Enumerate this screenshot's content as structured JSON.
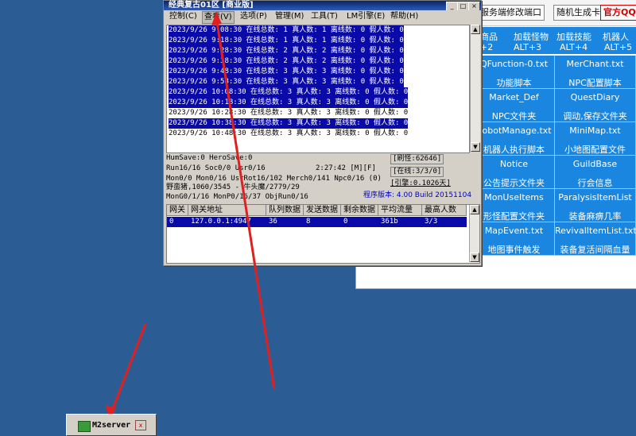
{
  "background_tool": {
    "top_tabs": [
      "服务端修改端口",
      "随机生成卡密",
      "官方QQ群"
    ],
    "blue_row_top": [
      "商品",
      "加载怪物",
      "加载技能",
      "机器人"
    ],
    "blue_row_bottom": [
      "+2",
      "ALT+3",
      "ALT+4",
      "ALT+5"
    ],
    "tiles": [
      {
        "file": "QFunction-0.txt",
        "desc": "功能脚本"
      },
      {
        "file": "MerChant.txt",
        "desc": "NPC配置脚本"
      },
      {
        "file": "Market_Def",
        "desc": "NPC文件夹"
      },
      {
        "file": "QuestDiary",
        "desc": "调动,保存文件夹"
      },
      {
        "file": "RobotManage.txt",
        "desc": "机器人执行脚本"
      },
      {
        "file": "MiniMap.txt",
        "desc": "小地图配置文件"
      },
      {
        "file": "Notice",
        "desc": "公告提示文件夹"
      },
      {
        "file": "GuildBase",
        "desc": "行会信息"
      },
      {
        "file": "MonUseItems",
        "desc": "形怪配置文件夹"
      },
      {
        "file": "ParalysisItemList",
        "desc": "装备麻痹几率"
      },
      {
        "file": "MapEvent.txt",
        "desc": "地图事件触发"
      },
      {
        "file": "RevivalItemList.txt",
        "desc": "装备复活间隔血量"
      }
    ]
  },
  "main_window": {
    "title": "经典复古01区 [商业版]",
    "menu": [
      "控制(C)",
      "查看(V)",
      "选项(P)",
      "管理(M)",
      "工具(T)",
      "LM引擎(E)",
      "帮助(H)"
    ],
    "log_lines": [
      {
        "text": "2023/9/26 9:08:30 在线总数: 1 真人数: 1 离线数: 0 假人数: 0",
        "selected": true
      },
      {
        "text": "2023/9/26 9:18:30 在线总数: 1 真人数: 1 离线数: 0 假人数: 0",
        "selected": true
      },
      {
        "text": "2023/9/26 9:28:30 在线总数: 2 真人数: 2 离线数: 0 假人数: 0",
        "selected": true
      },
      {
        "text": "2023/9/26 9:38:30 在线总数: 2 真人数: 2 离线数: 0 假人数: 0",
        "selected": true
      },
      {
        "text": "2023/9/26 9:48:30 在线总数: 3 真人数: 3 离线数: 0 假人数: 0",
        "selected": true
      },
      {
        "text": "2023/9/26 9:58:30 在线总数: 3 真人数: 3 离线数: 0 假人数: 0",
        "selected": true
      },
      {
        "text": "2023/9/26 10:08:30 在线总数: 3 真人数: 3 离线数: 0 假人数: 0",
        "selected": true
      },
      {
        "text": "2023/9/26 10:18:30 在线总数: 3 真人数: 3 离线数: 0 假人数: 0",
        "selected": true
      },
      {
        "text": "2023/9/26 10:28:30 在线总数: 3 真人数: 3 离线数: 0 假人数: 0",
        "selected": false
      },
      {
        "text": "2023/9/26 10:38:30 在线总数: 3 真人数: 3 离线数: 0 假人数: 0",
        "selected": true
      },
      {
        "text": "2023/9/26 10:48:30 在线总数: 3 真人数: 3 离线数: 0 假人数: 0",
        "selected": false
      }
    ],
    "stats": {
      "humsave": "HumSave:0 HeroSave:0",
      "refresh": "[刷怪:62646]",
      "run": "Run16/16 Soc0/0 Usr0/16",
      "time": "2:27:42 [M][F]",
      "online": "[在线:3/3/0]",
      "mon": "Mon0/0 Mon0/16 UsrRot16/102 Merch0/141 Npc0/16 (0)",
      "engine": "[引擎:0.1026天]",
      "wild": "野蛮猪,1060/3545 - 牛头魔/2779/29",
      "mongo": "MonG0/1/16 MonP0/16/37 ObjRun0/16",
      "version": "程序版本: 4.00 Build 20151104"
    },
    "table": {
      "headers": [
        "网关",
        "网关地址",
        "队列数据",
        "发送数据",
        "剩余数据",
        "平均流量",
        "最高人数"
      ],
      "rows": [
        [
          "0",
          "127.0.0.1:4947",
          "36",
          "8",
          "0",
          "361b",
          "3/3"
        ]
      ]
    }
  },
  "taskbar": {
    "label": "M2server"
  },
  "colors": {
    "desktop": "#2b5d94",
    "selection": "#0a0aa8",
    "tile_blue": "#1a86e0",
    "arrow_red": "#e02020"
  }
}
